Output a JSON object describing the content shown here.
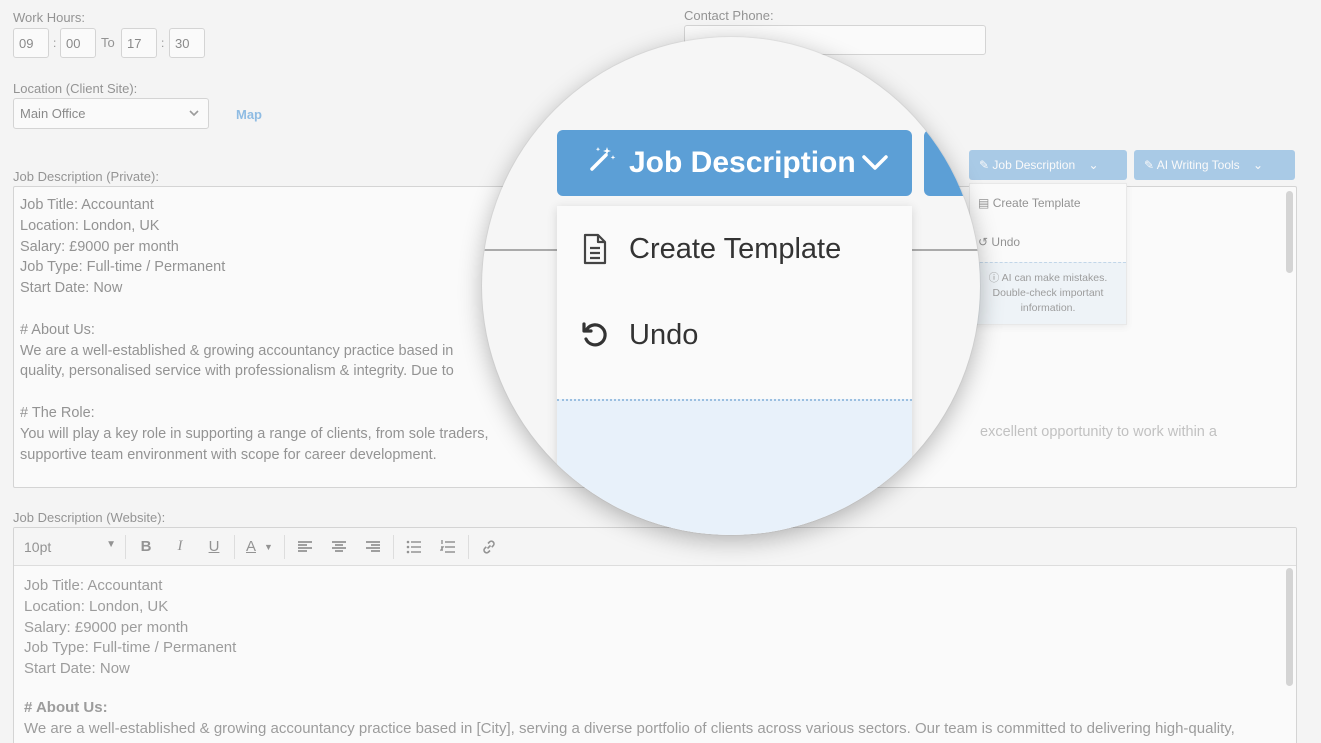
{
  "work_hours": {
    "label": "Work Hours:",
    "start_hour": "09",
    "start_minute": "00",
    "to_label": "To",
    "end_hour": "17",
    "end_minute": "30",
    "separator": ":"
  },
  "contact_phone": {
    "label": "Contact Phone:",
    "value": ""
  },
  "location": {
    "label": "Location (Client Site):",
    "selected": "Main Office",
    "map_link": "Map"
  },
  "job_description_private": {
    "label": "Job Description (Private):",
    "lines": [
      "Job Title: Accountant",
      "Location: London, UK",
      "Salary: £9000 per month",
      "Job Type: Full-time / Permanent",
      "Start Date: Now",
      "",
      "# About Us:",
      "We are a well-established & growing accountancy practice based in",
      "quality, personalised service with professionalism & integrity. Due to",
      "",
      "# The Role:",
      "You will play a key role in supporting a range of clients, from sole traders,",
      "supportive team environment with scope for career development."
    ],
    "overflow_text": "excellent opportunity to work within a"
  },
  "toolbar_buttons": {
    "job_description": "Job Description",
    "ai_writing_tools": "AI Writing Tools"
  },
  "dropdown_menu": {
    "create_template": "Create Template",
    "undo": "Undo",
    "notice": [
      "AI can make mistakes.",
      "Double-check important",
      "information."
    ]
  },
  "job_description_website": {
    "label": "Job Description (Website):",
    "font_size": "10pt",
    "lines": [
      "Job Title: Accountant",
      "Location: London, UK",
      "Salary: £9000 per month",
      "Job Type: Full-time / Permanent",
      "Start Date: Now",
      ""
    ],
    "heading": "# About Us:",
    "paragraph": "We are a well-established & growing accountancy practice based in [City], serving a diverse portfolio of clients across various sectors. Our team is committed to delivering high-quality,"
  },
  "magnifier": {
    "button_label": "Job Description",
    "create_template": "Create Template",
    "undo": "Undo"
  },
  "colors": {
    "accent": "#5c9fd6",
    "notice_bg": "#e8f1fa",
    "link": "#3d8fd6"
  },
  "icons": {
    "wand": "magic-wand-icon",
    "chevron": "chevron-down-icon",
    "document": "document-icon",
    "undo": "undo-icon",
    "info": "info-icon",
    "link": "link-icon"
  }
}
